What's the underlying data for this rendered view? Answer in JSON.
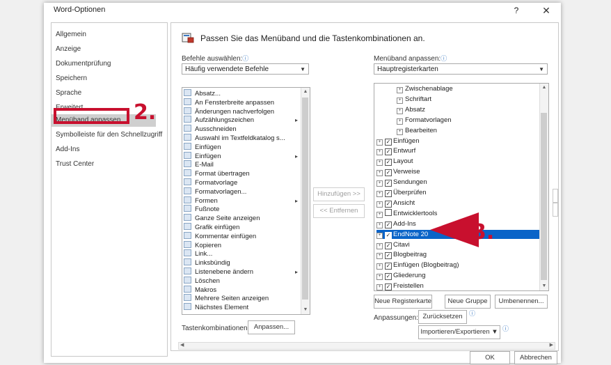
{
  "dialog": {
    "title": "Word-Optionen",
    "help": "?",
    "close": "✕"
  },
  "nav": {
    "items": [
      {
        "label": "Allgemein"
      },
      {
        "label": "Anzeige"
      },
      {
        "label": "Dokumentprüfung"
      },
      {
        "label": "Speichern"
      },
      {
        "label": "Sprache"
      },
      {
        "label": "Erweitert"
      },
      {
        "label": "Menüband anpassen"
      },
      {
        "label": "Symbolleiste für den Schnellzugriff"
      },
      {
        "label": "Add-Ins"
      },
      {
        "label": "Trust Center"
      }
    ],
    "selected": "Menüband anpassen"
  },
  "header": {
    "text": "Passen Sie das Menüband und die Tastenkombinationen an."
  },
  "left": {
    "label": "Befehle auswählen:",
    "info": "ⓘ",
    "select_value": "Häufig verwendete Befehle",
    "commands": [
      {
        "label": "Absatz..."
      },
      {
        "label": "An Fensterbreite anpassen"
      },
      {
        "label": "Änderungen nachverfolgen"
      },
      {
        "label": "Aufzählungszeichen",
        "submenu": "▸"
      },
      {
        "label": "Ausschneiden"
      },
      {
        "label": "Auswahl im Textfeldkatalog s..."
      },
      {
        "label": "Einfügen"
      },
      {
        "label": "Einfügen",
        "submenu": "▸"
      },
      {
        "label": "E-Mail"
      },
      {
        "label": "Format übertragen"
      },
      {
        "label": "Formatvorlage"
      },
      {
        "label": "Formatvorlagen..."
      },
      {
        "label": "Formen",
        "submenu": "▸"
      },
      {
        "label": "Fußnote"
      },
      {
        "label": "Ganze Seite anzeigen"
      },
      {
        "label": "Grafik einfügen"
      },
      {
        "label": "Kommentar einfügen"
      },
      {
        "label": "Kopieren"
      },
      {
        "label": "Link..."
      },
      {
        "label": "Linksbündig"
      },
      {
        "label": "Listenebene ändern",
        "submenu": "▸"
      },
      {
        "label": "Löschen"
      },
      {
        "label": "Makros"
      },
      {
        "label": "Mehrere Seiten anzeigen"
      },
      {
        "label": "Nächstes Element"
      }
    ],
    "shortcut_label": "Tastenkombinationen:",
    "shortcut_button": "Anpassen..."
  },
  "middle": {
    "add": "Hinzufügen >>",
    "remove": "<< Entfernen"
  },
  "right": {
    "label": "Menüband anpassen:",
    "info": "ⓘ",
    "select_value": "Hauptregisterkarten",
    "tree": [
      {
        "label": "Zwischenablage",
        "level": 2,
        "expand": "⊞",
        "check": ""
      },
      {
        "label": "Schriftart",
        "level": 2,
        "expand": "⊞",
        "check": ""
      },
      {
        "label": "Absatz",
        "level": 2,
        "expand": "⊞",
        "check": ""
      },
      {
        "label": "Formatvorlagen",
        "level": 2,
        "expand": "⊞",
        "check": ""
      },
      {
        "label": "Bearbeiten",
        "level": 2,
        "expand": "⊞",
        "check": ""
      },
      {
        "label": "Einfügen",
        "level": 1,
        "expand": "⊞",
        "check": "✓"
      },
      {
        "label": "Entwurf",
        "level": 1,
        "expand": "⊞",
        "check": "✓"
      },
      {
        "label": "Layout",
        "level": 1,
        "expand": "⊞",
        "check": "✓"
      },
      {
        "label": "Verweise",
        "level": 1,
        "expand": "⊞",
        "check": "✓"
      },
      {
        "label": "Sendungen",
        "level": 1,
        "expand": "⊞",
        "check": "✓"
      },
      {
        "label": "Überprüfen",
        "level": 1,
        "expand": "⊞",
        "check": "✓"
      },
      {
        "label": "Ansicht",
        "level": 1,
        "expand": "⊞",
        "check": "✓"
      },
      {
        "label": "Entwicklertools",
        "level": 1,
        "expand": "⊞",
        "check": "☐"
      },
      {
        "label": "Add-Ins",
        "level": 1,
        "expand": "⊞",
        "check": "✓"
      },
      {
        "label": "EndNote 20",
        "level": 1,
        "expand": "⊞",
        "check": "✓",
        "selected": true
      },
      {
        "label": "Citavi",
        "level": 1,
        "expand": "⊞",
        "check": "✓"
      },
      {
        "label": "Blogbeitrag",
        "level": 1,
        "expand": "⊞",
        "check": "✓"
      },
      {
        "label": "Einfügen (Blogbeitrag)",
        "level": 1,
        "expand": "⊞",
        "check": "✓"
      },
      {
        "label": "Gliederung",
        "level": 1,
        "expand": "⊞",
        "check": "✓"
      },
      {
        "label": "Freistellen",
        "level": 1,
        "expand": "⊞",
        "check": "✓"
      }
    ],
    "new_tab": "Neue Registerkarte",
    "new_group": "Neue Gruppe",
    "rename": "Umbenennen...",
    "anpassungen_label": "Anpassungen:",
    "reset_button": "Zurücksetzen ▼",
    "import_button": "Importieren/Exportieren ▼"
  },
  "footer": {
    "ok": "OK",
    "cancel": "Abbrechen"
  },
  "annotations": {
    "step2": "2.",
    "step3": "3.",
    "color": "#c8102e"
  }
}
